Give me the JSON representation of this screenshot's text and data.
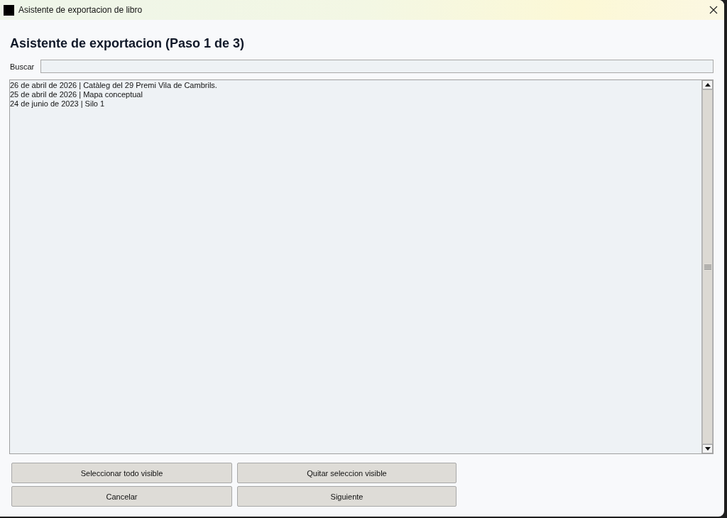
{
  "window": {
    "title": "Asistente de exportacion de libro"
  },
  "heading": "Asistente de exportacion (Paso 1 de 3)",
  "search": {
    "label": "Buscar"
  },
  "list": {
    "items": [
      "26 de abril de 2026 | Catàleg del 29 Premi Vila de Cambrils.",
      "25 de abril de 2026 | Mapa conceptual",
      "24 de junio de 2023 | Silo 1"
    ]
  },
  "buttons": [
    [
      "Seleccionar todo visible",
      "Quitar seleccion visible"
    ],
    [
      "Cancelar",
      "Siguiente"
    ]
  ]
}
